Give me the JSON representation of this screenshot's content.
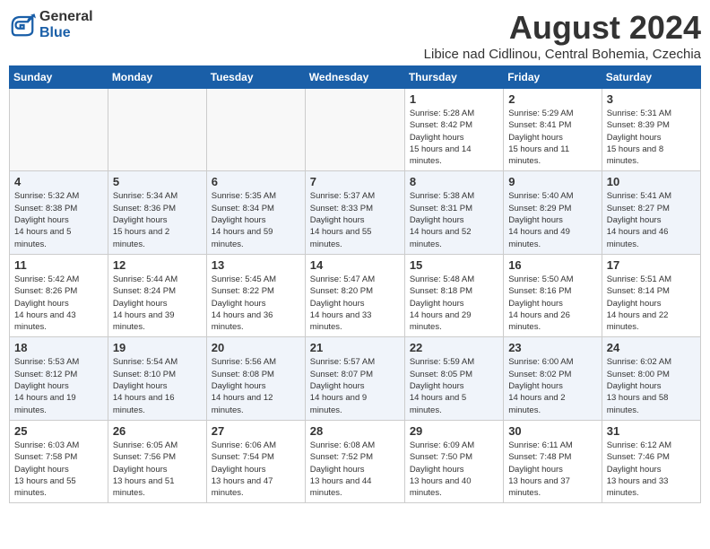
{
  "header": {
    "logo_general": "General",
    "logo_blue": "Blue",
    "month_title": "August 2024",
    "location": "Libice nad Cidlinou, Central Bohemia, Czechia"
  },
  "weekdays": [
    "Sunday",
    "Monday",
    "Tuesday",
    "Wednesday",
    "Thursday",
    "Friday",
    "Saturday"
  ],
  "weeks": [
    [
      {
        "day": "",
        "empty": true
      },
      {
        "day": "",
        "empty": true
      },
      {
        "day": "",
        "empty": true
      },
      {
        "day": "",
        "empty": true
      },
      {
        "day": "1",
        "sunrise": "5:28 AM",
        "sunset": "8:42 PM",
        "daylight": "15 hours and 14 minutes."
      },
      {
        "day": "2",
        "sunrise": "5:29 AM",
        "sunset": "8:41 PM",
        "daylight": "15 hours and 11 minutes."
      },
      {
        "day": "3",
        "sunrise": "5:31 AM",
        "sunset": "8:39 PM",
        "daylight": "15 hours and 8 minutes."
      }
    ],
    [
      {
        "day": "4",
        "sunrise": "5:32 AM",
        "sunset": "8:38 PM",
        "daylight": "14 hours and 5 minutes."
      },
      {
        "day": "5",
        "sunrise": "5:34 AM",
        "sunset": "8:36 PM",
        "daylight": "15 hours and 2 minutes."
      },
      {
        "day": "6",
        "sunrise": "5:35 AM",
        "sunset": "8:34 PM",
        "daylight": "14 hours and 59 minutes."
      },
      {
        "day": "7",
        "sunrise": "5:37 AM",
        "sunset": "8:33 PM",
        "daylight": "14 hours and 55 minutes."
      },
      {
        "day": "8",
        "sunrise": "5:38 AM",
        "sunset": "8:31 PM",
        "daylight": "14 hours and 52 minutes."
      },
      {
        "day": "9",
        "sunrise": "5:40 AM",
        "sunset": "8:29 PM",
        "daylight": "14 hours and 49 minutes."
      },
      {
        "day": "10",
        "sunrise": "5:41 AM",
        "sunset": "8:27 PM",
        "daylight": "14 hours and 46 minutes."
      }
    ],
    [
      {
        "day": "11",
        "sunrise": "5:42 AM",
        "sunset": "8:26 PM",
        "daylight": "14 hours and 43 minutes."
      },
      {
        "day": "12",
        "sunrise": "5:44 AM",
        "sunset": "8:24 PM",
        "daylight": "14 hours and 39 minutes."
      },
      {
        "day": "13",
        "sunrise": "5:45 AM",
        "sunset": "8:22 PM",
        "daylight": "14 hours and 36 minutes."
      },
      {
        "day": "14",
        "sunrise": "5:47 AM",
        "sunset": "8:20 PM",
        "daylight": "14 hours and 33 minutes."
      },
      {
        "day": "15",
        "sunrise": "5:48 AM",
        "sunset": "8:18 PM",
        "daylight": "14 hours and 29 minutes."
      },
      {
        "day": "16",
        "sunrise": "5:50 AM",
        "sunset": "8:16 PM",
        "daylight": "14 hours and 26 minutes."
      },
      {
        "day": "17",
        "sunrise": "5:51 AM",
        "sunset": "8:14 PM",
        "daylight": "14 hours and 22 minutes."
      }
    ],
    [
      {
        "day": "18",
        "sunrise": "5:53 AM",
        "sunset": "8:12 PM",
        "daylight": "14 hours and 19 minutes."
      },
      {
        "day": "19",
        "sunrise": "5:54 AM",
        "sunset": "8:10 PM",
        "daylight": "14 hours and 16 minutes."
      },
      {
        "day": "20",
        "sunrise": "5:56 AM",
        "sunset": "8:08 PM",
        "daylight": "14 hours and 12 minutes."
      },
      {
        "day": "21",
        "sunrise": "5:57 AM",
        "sunset": "8:07 PM",
        "daylight": "14 hours and 9 minutes."
      },
      {
        "day": "22",
        "sunrise": "5:59 AM",
        "sunset": "8:05 PM",
        "daylight": "14 hours and 5 minutes."
      },
      {
        "day": "23",
        "sunrise": "6:00 AM",
        "sunset": "8:02 PM",
        "daylight": "14 hours and 2 minutes."
      },
      {
        "day": "24",
        "sunrise": "6:02 AM",
        "sunset": "8:00 PM",
        "daylight": "13 hours and 58 minutes."
      }
    ],
    [
      {
        "day": "25",
        "sunrise": "6:03 AM",
        "sunset": "7:58 PM",
        "daylight": "13 hours and 55 minutes."
      },
      {
        "day": "26",
        "sunrise": "6:05 AM",
        "sunset": "7:56 PM",
        "daylight": "13 hours and 51 minutes."
      },
      {
        "day": "27",
        "sunrise": "6:06 AM",
        "sunset": "7:54 PM",
        "daylight": "13 hours and 47 minutes."
      },
      {
        "day": "28",
        "sunrise": "6:08 AM",
        "sunset": "7:52 PM",
        "daylight": "13 hours and 44 minutes."
      },
      {
        "day": "29",
        "sunrise": "6:09 AM",
        "sunset": "7:50 PM",
        "daylight": "13 hours and 40 minutes."
      },
      {
        "day": "30",
        "sunrise": "6:11 AM",
        "sunset": "7:48 PM",
        "daylight": "13 hours and 37 minutes."
      },
      {
        "day": "31",
        "sunrise": "6:12 AM",
        "sunset": "7:46 PM",
        "daylight": "13 hours and 33 minutes."
      }
    ]
  ]
}
